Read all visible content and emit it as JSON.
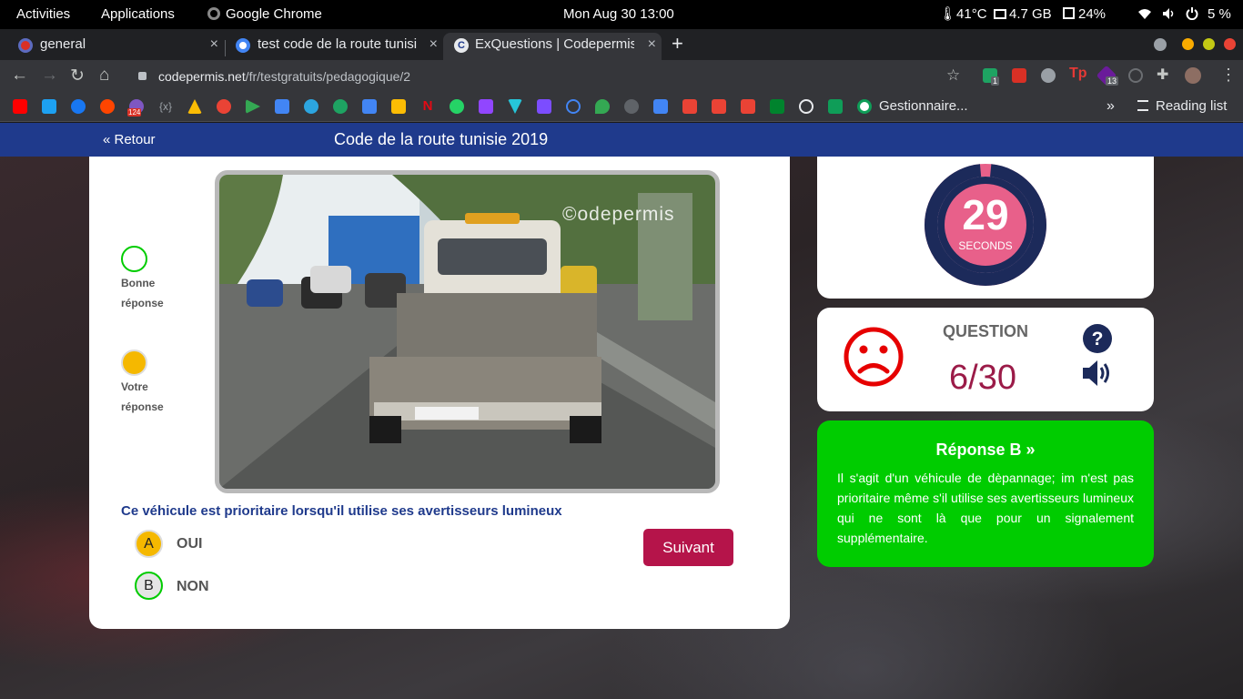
{
  "system_bar": {
    "activities": "Activities",
    "applications": "Applications",
    "app_name": "Google Chrome",
    "datetime": "Mon Aug 30  13:00",
    "temperature": "41°C",
    "memory": "4.7 GB",
    "disk": "24%",
    "battery": "5 %"
  },
  "tabs": [
    {
      "title": "general",
      "close": "×"
    },
    {
      "title": "test code de la route tunisie",
      "close": "×"
    },
    {
      "title": "ExQuestions | Codepermis",
      "close": "×"
    }
  ],
  "new_tab": "+",
  "toolbar": {
    "url_host": "codepermis.net",
    "url_path": "/fr/testgratuits/pedagogique/2",
    "ext_badge_1": "1",
    "ext_badge_2": "13"
  },
  "bookmarks": {
    "youtube_badge": "124",
    "gestionnaire": "Gestionnaire...",
    "more": "»",
    "reading_list": "Reading list"
  },
  "site": {
    "back_label": "« Retour",
    "title": "Code de la route tunisie 2019"
  },
  "quiz": {
    "photo_watermark": "©odepermis",
    "legend_good_1": "Bonne",
    "legend_good_2": "réponse",
    "legend_yours_1": "Votre",
    "legend_yours_2": "réponse",
    "question": "Ce véhicule est prioritaire lorsqu'il utilise ses avertisseurs lumineux",
    "options": [
      {
        "letter": "A",
        "label": "OUI"
      },
      {
        "letter": "B",
        "label": "NON"
      }
    ],
    "next_label": "Suivant"
  },
  "timer": {
    "value": "29",
    "unit": "SECONDS",
    "remaining_fraction": 0.97
  },
  "question_panel": {
    "label": "QUESTION",
    "count": "6/30"
  },
  "answer": {
    "title": "Réponse B »",
    "text": "Il s'agit d'un véhicule de dèpannage; im n'est pas prioritaire même s'il utilise ses avertisseurs lumineux qui ne sont là que pour un signalement supplémentaire."
  },
  "colors": {
    "header": "#1f3a8c",
    "good_answer": "#00cc00",
    "your_answer": "#f5b800",
    "next_button": "#b5144a",
    "timer_ring": "#1c2a5a",
    "timer_center": "#e8608a",
    "sad_face": "#e60000"
  }
}
